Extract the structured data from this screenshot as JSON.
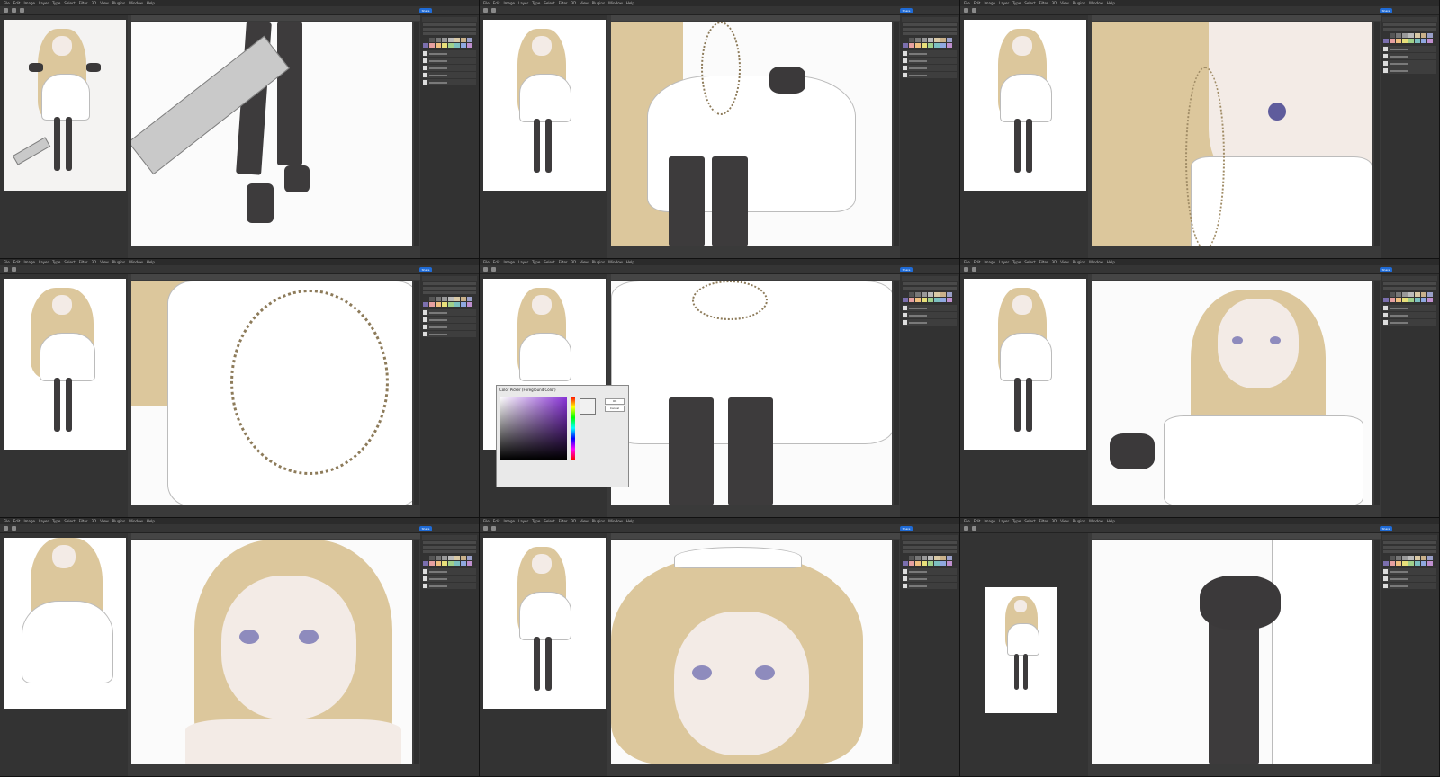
{
  "menu_items": [
    "File",
    "Edit",
    "Image",
    "Layer",
    "Type",
    "Select",
    "Filter",
    "3D",
    "View",
    "Plugins",
    "Window",
    "Help"
  ],
  "share_label": "Share",
  "panels": {
    "swatches": [
      "#333333",
      "#555555",
      "#777777",
      "#999999",
      "#bbbbbb",
      "#d9c9a6",
      "#c9b18a",
      "#9aa0c9",
      "#7b6fae",
      "#e6a0a0",
      "#f0c080",
      "#e8e07a",
      "#a0d08a",
      "#7cc0c0",
      "#8fa8e0",
      "#c090d0"
    ]
  },
  "color_picker": {
    "title": "Color Picker (Foreground Color)",
    "ok_label": "OK",
    "cancel_label": "Cancel"
  }
}
